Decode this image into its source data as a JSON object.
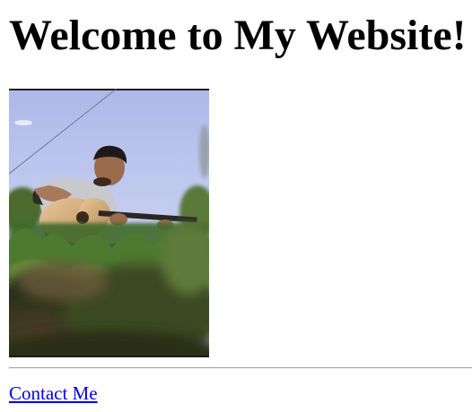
{
  "page": {
    "heading": "Welcome to My Website!",
    "contact_link": "Contact Me"
  },
  "colors": {
    "link": "#0000ee",
    "text": "#000000",
    "background": "#ffffff"
  }
}
